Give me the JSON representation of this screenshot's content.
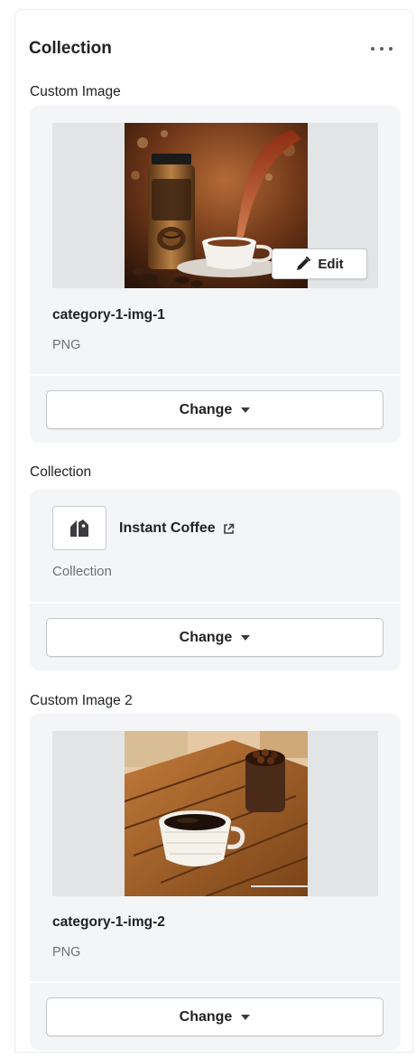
{
  "header": {
    "title": "Collection",
    "menu_icon": "more-horizontal-icon"
  },
  "sections": {
    "image1": {
      "label": "Custom Image",
      "file_name": "category-1-img-1",
      "file_type": "PNG",
      "edit_label": "Edit",
      "change_label": "Change"
    },
    "collection": {
      "label": "Collection",
      "name": "Instant Coffee",
      "subtitle": "Collection",
      "change_label": "Change"
    },
    "image2": {
      "label": "Custom Image 2",
      "file_name": "category-1-img-2",
      "file_type": "PNG",
      "change_label": "Change"
    }
  },
  "colors": {
    "card_bg": "#f4f5f7",
    "image_bg": "#e3e4e6",
    "text": "#202223",
    "subdued_text": "#6d7175"
  }
}
